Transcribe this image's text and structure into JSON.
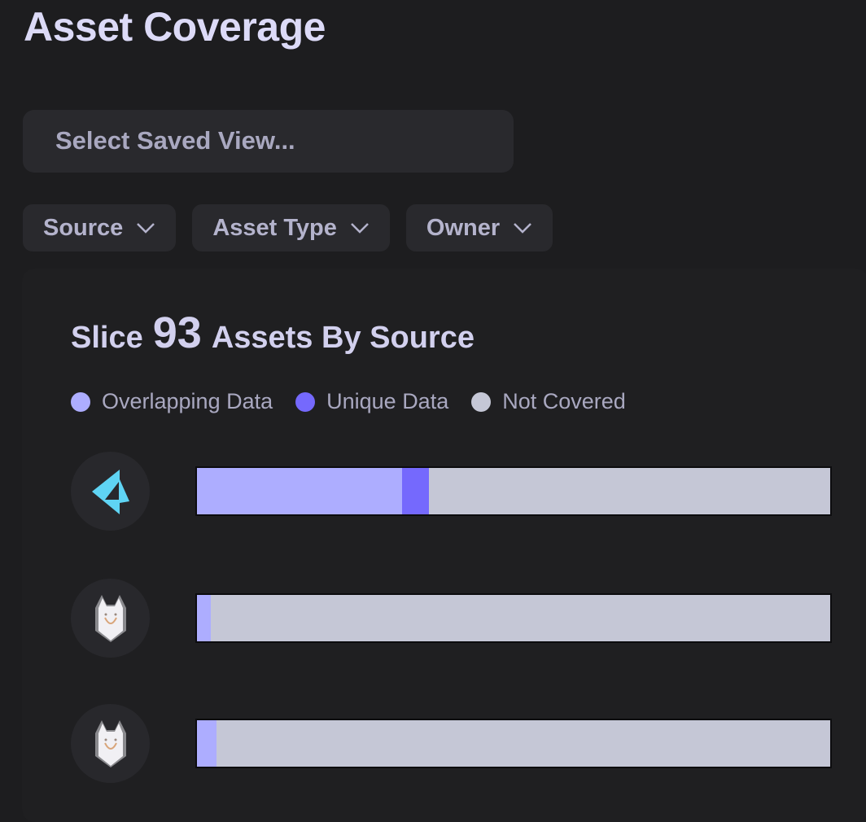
{
  "page": {
    "title": "Asset Coverage"
  },
  "saved_view": {
    "placeholder": "Select Saved View..."
  },
  "filters": [
    {
      "label": "Source"
    },
    {
      "label": "Asset Type"
    },
    {
      "label": "Owner"
    }
  ],
  "summary": {
    "prefix": "Slice",
    "count": "93",
    "suffix": "Assets By Source"
  },
  "colors": {
    "overlapping": "#adadff",
    "unique": "#7569fd",
    "not_covered": "#c5c7d6",
    "accent_logo": "#5fd4f4"
  },
  "chart_data": {
    "type": "bar",
    "orientation": "horizontal-stacked-percent",
    "legend": [
      "Overlapping Data",
      "Unique Data",
      "Not Covered"
    ],
    "categories": [
      "source-1 (blue triangle logo)",
      "source-2 (wolf logo)",
      "source-3 (wolf logo)"
    ],
    "series": [
      {
        "name": "Overlapping Data",
        "values": [
          32.4,
          2.2,
          3.1
        ]
      },
      {
        "name": "Unique Data",
        "values": [
          4.2,
          0,
          0
        ]
      },
      {
        "name": "Not Covered",
        "values": [
          63.4,
          97.8,
          96.9
        ]
      }
    ],
    "xlim": [
      0,
      100
    ]
  },
  "rows": [
    {
      "icon": "triangle-logo-icon"
    },
    {
      "icon": "wolf-logo-icon"
    },
    {
      "icon": "wolf-logo-icon"
    }
  ]
}
